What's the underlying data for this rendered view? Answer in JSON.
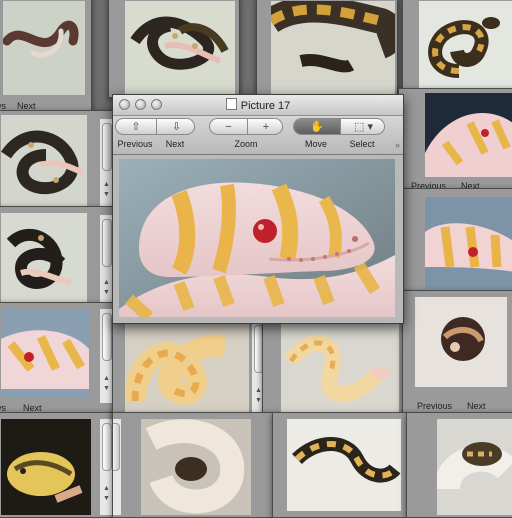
{
  "main_window": {
    "title": "Picture 17",
    "toolbar": {
      "previous_label": "Previous",
      "next_label": "Next",
      "zoom_label": "Zoom",
      "move_label": "Move",
      "select_label": "Select"
    }
  },
  "background_windows": {
    "top_left_previous_fragment": "vs",
    "top_left_next": "Next",
    "mid_left_previous_fragment": "vs",
    "mid_left_next": "Next",
    "right_previous_fragment": "Previous",
    "right_next_fragment": "Next",
    "bottom_right_previous": "Previous",
    "bottom_right_next": "Next"
  },
  "colors": {
    "desktop": "#6f6f6f",
    "window_chrome": "#b9b9b9",
    "albino_yellow": "#e8b84a",
    "albino_pink": "#f0d6d8",
    "eye_red": "#c0202a"
  },
  "icons": {
    "previous": "arrow-up-page-icon",
    "next": "arrow-down-page-icon",
    "zoom_out": "minus-icon",
    "zoom_in": "plus-icon",
    "move": "hand-icon",
    "select": "dashed-selection-icon"
  }
}
